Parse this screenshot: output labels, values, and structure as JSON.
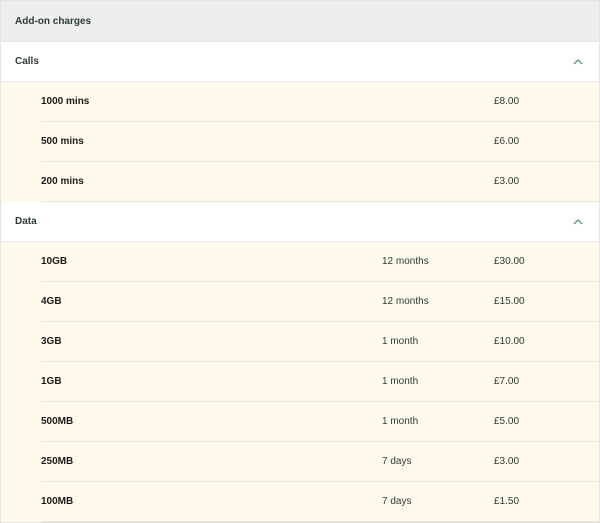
{
  "panel": {
    "title": "Add-on charges"
  },
  "sections": [
    {
      "title": "Calls",
      "expanded": true,
      "rows": [
        {
          "name": "1000 mins",
          "duration": "",
          "price": "£8.00"
        },
        {
          "name": "500 mins",
          "duration": "",
          "price": "£6.00"
        },
        {
          "name": "200 mins",
          "duration": "",
          "price": "£3.00"
        }
      ]
    },
    {
      "title": "Data",
      "expanded": true,
      "rows": [
        {
          "name": "10GB",
          "duration": "12 months",
          "price": "£30.00"
        },
        {
          "name": "4GB",
          "duration": "12 months",
          "price": "£15.00"
        },
        {
          "name": "3GB",
          "duration": "1 month",
          "price": "£10.00"
        },
        {
          "name": "1GB",
          "duration": "1 month",
          "price": "£7.00"
        },
        {
          "name": "500MB",
          "duration": "1 month",
          "price": "£5.00"
        },
        {
          "name": "250MB",
          "duration": "7 days",
          "price": "£3.00"
        },
        {
          "name": "100MB",
          "duration": "7 days",
          "price": "£1.50"
        }
      ]
    }
  ],
  "icons": {
    "collapse": "chevron-up-icon"
  },
  "colors": {
    "accent": "#3e8e5f",
    "row_background": "#fffaec",
    "header_background": "#eeeeee"
  }
}
